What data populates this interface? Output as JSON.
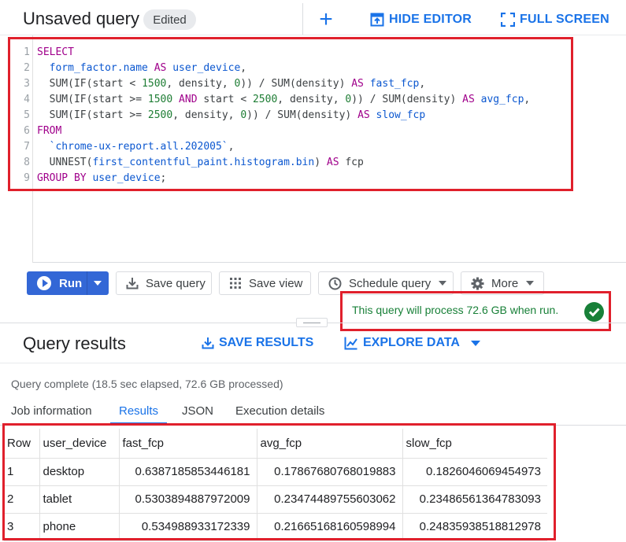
{
  "header": {
    "title": "Unsaved query",
    "status_chip": "Edited",
    "add_icon": "plus-icon",
    "hide_editor_label": "HIDE EDITOR",
    "full_screen_label": "FULL SCREEN"
  },
  "editor": {
    "line_numbers": [
      "1",
      "2",
      "3",
      "4",
      "5",
      "6",
      "7",
      "8",
      "9"
    ],
    "lines": [
      "SELECT",
      "  form_factor.name AS user_device,",
      "  SUM(IF(start < 1500, density, 0)) / SUM(density) AS fast_fcp,",
      "  SUM(IF(start >= 1500 AND start < 2500, density, 0)) / SUM(density) AS avg_fcp,",
      "  SUM(IF(start >= 2500, density, 0)) / SUM(density) AS slow_fcp",
      "FROM",
      "  `chrome-ux-report.all.202005`,",
      "  UNNEST(first_contentful_paint.histogram.bin) AS fcp",
      "GROUP BY user_device;"
    ]
  },
  "toolbar": {
    "run_label": "Run",
    "save_query_label": "Save query",
    "save_view_label": "Save view",
    "schedule_query_label": "Schedule query",
    "more_label": "More"
  },
  "validator": {
    "message": "This query will process 72.6 GB when run.",
    "status_color": "#188038"
  },
  "results": {
    "title": "Query results",
    "save_results_label": "SAVE RESULTS",
    "explore_data_label": "EXPLORE DATA",
    "status": "Query complete (18.5 sec elapsed, 72.6 GB processed)",
    "tabs": [
      "Job information",
      "Results",
      "JSON",
      "Execution details"
    ],
    "active_tab": "Results",
    "columns": [
      "Row",
      "user_device",
      "fast_fcp",
      "avg_fcp",
      "slow_fcp"
    ],
    "rows": [
      [
        "1",
        "desktop",
        "0.6387185853446181",
        "0.17867680768019883",
        "0.1826046069454973"
      ],
      [
        "2",
        "tablet",
        "0.5303894887972009",
        "0.23474489755603062",
        "0.23486561364783093"
      ],
      [
        "3",
        "phone",
        "0.534988933172339",
        "0.21665168160598994",
        "0.24835938518812978"
      ]
    ]
  },
  "colors": {
    "accent": "#1a73e8",
    "run_button": "#3367d6",
    "highlight_box": "#e0202c"
  }
}
